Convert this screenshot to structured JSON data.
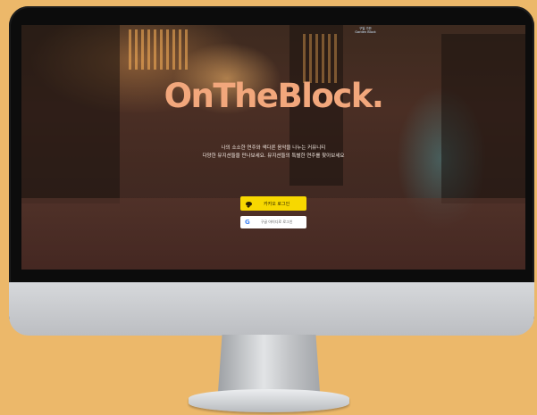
{
  "brand": {
    "name": "OnTheBlock."
  },
  "tagline": {
    "line1": "나의 소소한 연주와 색다른 음악을 나누는 커뮤니티",
    "line2": "다양한 뮤지션들을 만나보세요. 뮤지션들의 특별한 연주를 찾아보세요"
  },
  "login": {
    "kakao_label": "카카오 로그인",
    "google_label": "구글 아이디로 로그인",
    "google_icon_glyph": "G"
  },
  "background_sign": {
    "line1": "구일 가든",
    "line2": "Garden Block"
  },
  "colors": {
    "background": "#ecb86a",
    "brand": "#f2a77c",
    "kakao": "#f7d800",
    "google_button": "#ffffff"
  },
  "icons": {
    "kakao": "chat-bubble-icon",
    "google": "google-logo-icon"
  }
}
